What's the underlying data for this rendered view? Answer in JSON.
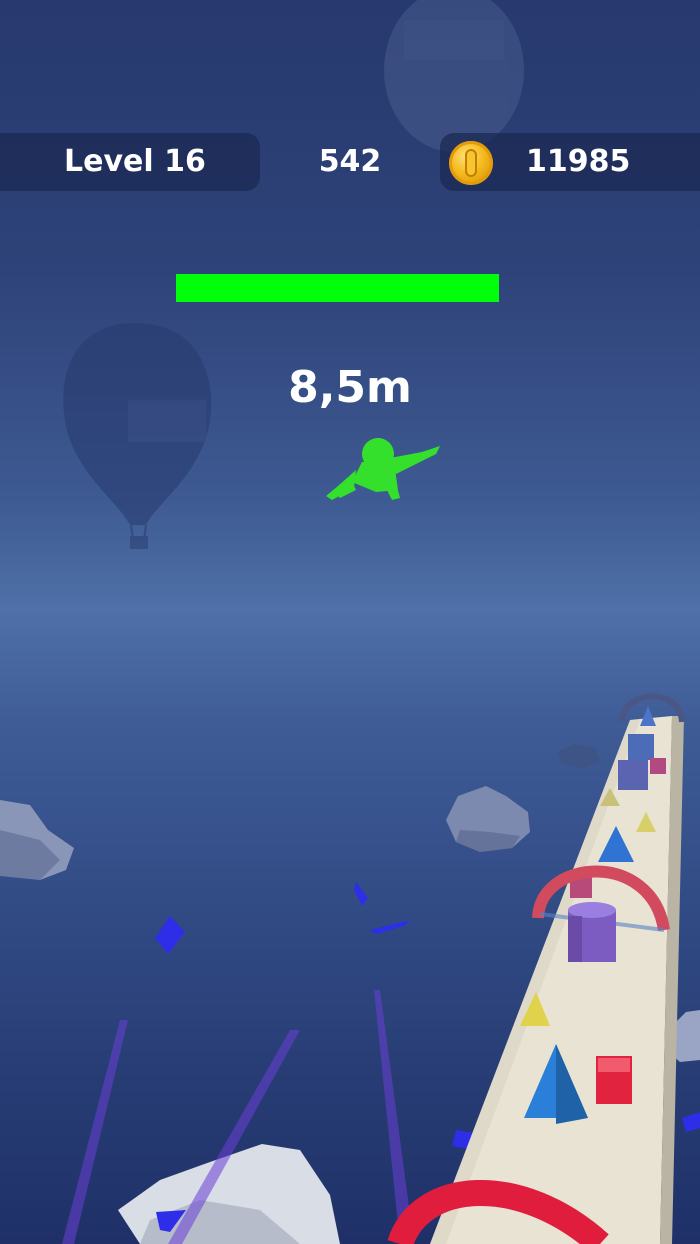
{
  "hud": {
    "level_label": "Level 16",
    "score": "542",
    "coins": "11985",
    "coin_icon": "gold-coin-icon"
  },
  "progress": {
    "fraction": 1.0,
    "color": "#00ff08"
  },
  "distance": "8,5m",
  "colors": {
    "player": "#34e02c",
    "track": "#e8e3d2",
    "ring_red": "#e0213f",
    "sky_mid": "#4f70a8"
  }
}
